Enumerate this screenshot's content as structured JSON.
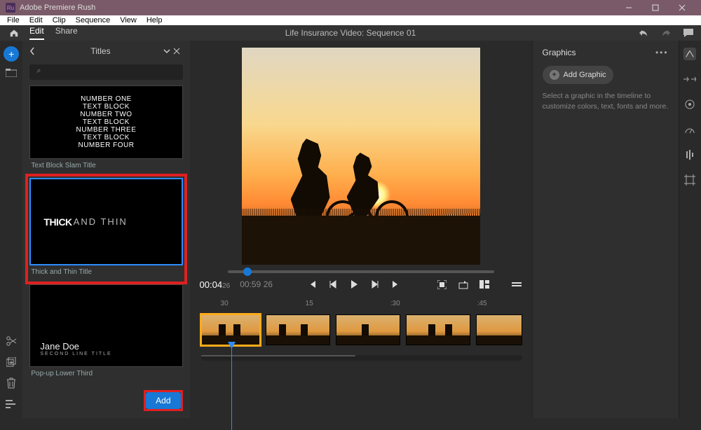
{
  "app": {
    "title": "Adobe Premiere Rush"
  },
  "menubar": [
    "File",
    "Edit",
    "Clip",
    "Sequence",
    "View",
    "Help"
  ],
  "subbar": {
    "tabs": {
      "edit": "Edit",
      "share": "Share"
    },
    "document_title": "Life Insurance Video: Sequence 01"
  },
  "titles_panel": {
    "header": "Titles",
    "search_placeholder": "",
    "items": [
      {
        "caption": "Text Block Slam Title",
        "lines": [
          "NUMBER ONE",
          "TEXT BLOCK",
          "NUMBER TWO",
          "TEXT BLOCK",
          "NUMBER THREE",
          "TEXT BLOCK",
          "NUMBER FOUR"
        ]
      },
      {
        "caption": "Thick and Thin Title",
        "thick": "THICK",
        "thin": "AND THIN",
        "selected": true
      },
      {
        "caption": "Pop-up Lower Third",
        "name": "Jane Doe",
        "sub": "Second Line Title"
      }
    ],
    "add_label": "Add"
  },
  "transport": {
    "current": "00:04",
    "current_frames": "26",
    "total": "00:59",
    "total_frames": "26"
  },
  "timeline": {
    "ruler": [
      ":30",
      ":45",
      ":30",
      ":45"
    ],
    "ruler_display": [
      "30",
      "15",
      ":30",
      ":45"
    ]
  },
  "graphics_panel": {
    "header": "Graphics",
    "add_label": "Add Graphic",
    "hint": "Select a graphic in the timeline to customize colors, text, fonts and more."
  }
}
